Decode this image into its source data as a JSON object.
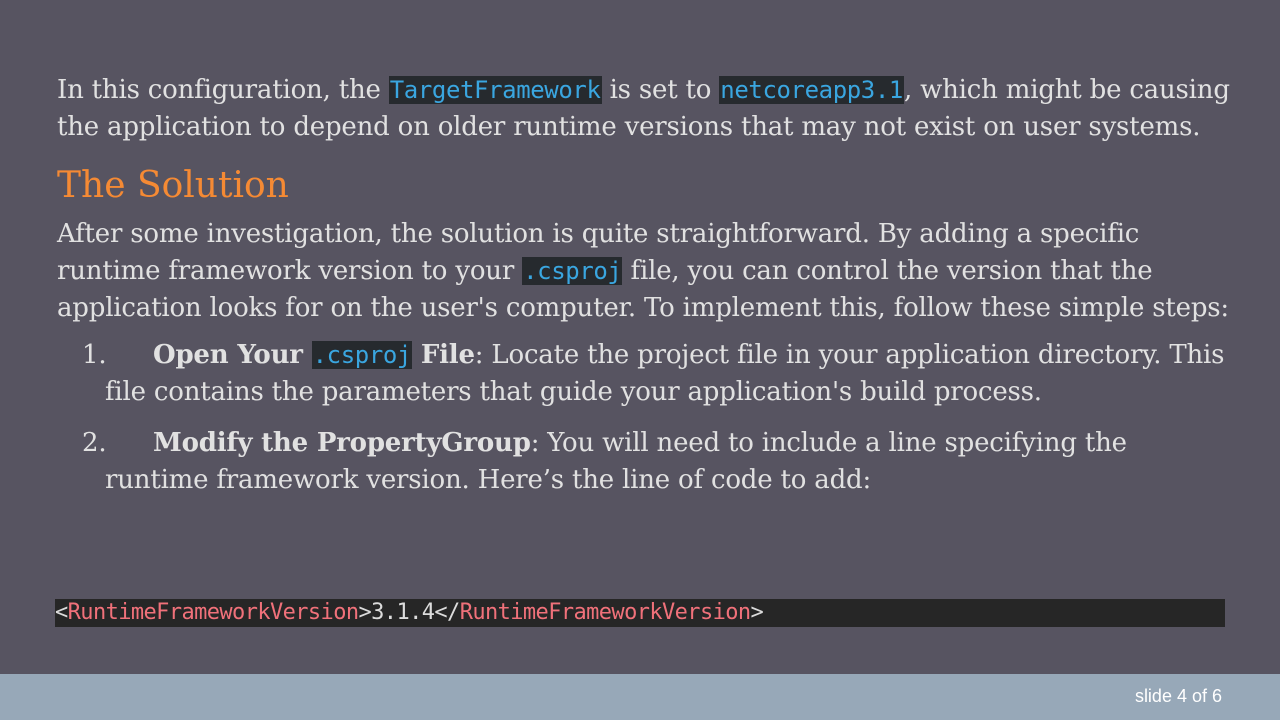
{
  "intro": {
    "t1": "In this configuration, the ",
    "c1": "TargetFramework",
    "t2": " is set to ",
    "c2": "netcoreapp3.1",
    "t3": ", which might be causing the application to depend on older runtime versions that may not exist on user systems."
  },
  "heading": "The Solution",
  "solution": {
    "t1": "After some investigation, the solution is quite straightforward. By adding a specific runtime framework version to your ",
    "c1": ".csproj",
    "t2": " file, you can control the version that the application looks for on the user's computer. To implement this, follow these simple steps:"
  },
  "steps": [
    {
      "num": "1.",
      "bold_a": "Open Your ",
      "code": ".csproj",
      "bold_b": " File",
      "text": ": Locate the project file in your application directory. This file contains the parameters that guide your application's build process."
    },
    {
      "num": "2.",
      "bold_a": "Modify the PropertyGroup",
      "text": ": You will need to include a line specifying the runtime framework version. Here’s the line of code to add:"
    }
  ],
  "code_line": {
    "lt1": "<",
    "open_tag": "RuntimeFrameworkVersion",
    "gt1": ">",
    "value": "3.1.4",
    "lt2": "</",
    "close_tag": "RuntimeFrameworkVersion",
    "gt2": ">"
  },
  "footer": {
    "slide_label": "slide 4 of 6"
  },
  "colors": {
    "background": "#575461",
    "heading": "#f58a34",
    "inline_code": "#3aa6e0",
    "tag": "#f0717a",
    "footer_bar": "#97a8b8"
  }
}
